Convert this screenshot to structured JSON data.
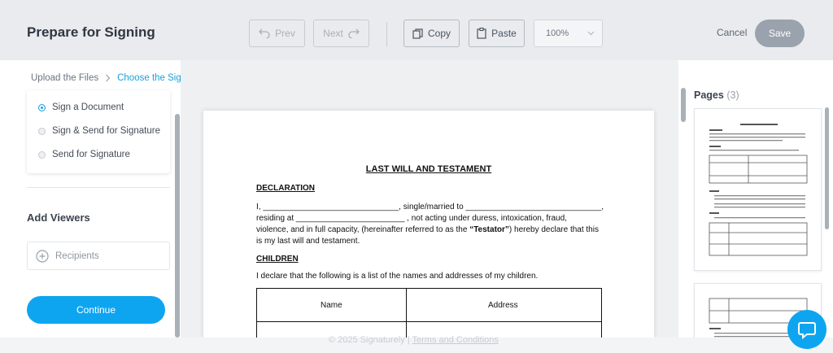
{
  "header": {
    "title": "Prepare for Signing",
    "prev_label": "Prev",
    "next_label": "Next",
    "copy_label": "Copy",
    "paste_label": "Paste",
    "zoom_value": "100%",
    "cancel_label": "Cancel",
    "save_label": "Save"
  },
  "breadcrumb": {
    "step1": "Upload the Files",
    "step2": "Choose the Signers"
  },
  "signing_modes": {
    "selected": "Sign a Document",
    "options": [
      "Sign a Document",
      "Sign & Send for Signature",
      "Send for Signature"
    ]
  },
  "viewers": {
    "title": "Add Viewers",
    "recipients_placeholder": "Recipients"
  },
  "continue_label": "Continue",
  "document": {
    "title": "LAST WILL AND TESTAMENT",
    "declaration_heading": "DECLARATION",
    "declaration_line1": "I, ______________________________, single/married to ______________________________,",
    "declaration_line2": "residing at ________________________ , not acting under duress, intoxication, fraud,",
    "declaration_line3_a": "violence, and in full capacity, (hereinafter referred to as the ",
    "declaration_line3_b": "“Testator”",
    "declaration_line3_c": ") hereby declare that this",
    "declaration_line4": "is my last will and testament.",
    "children_heading": "CHILDREN",
    "children_line": "I declare that the following is a list of the names and addresses of my children.",
    "table_headers": [
      "Name",
      "Address"
    ]
  },
  "pages": {
    "title": "Pages",
    "count": "(3)"
  },
  "footer": {
    "copyright": "© 2025 Signaturely |",
    "terms": "Terms and Conditions"
  },
  "icons": {
    "prev": "undo-arrow-icon",
    "next": "redo-arrow-icon",
    "copy": "copy-icon",
    "paste": "clipboard-icon",
    "add": "plus-circle-icon",
    "chat": "chat-bubble-icon"
  },
  "colors": {
    "accent": "#0ea5f0",
    "link": "#1aa0dc",
    "save_disabled": "#9aa2ad"
  }
}
